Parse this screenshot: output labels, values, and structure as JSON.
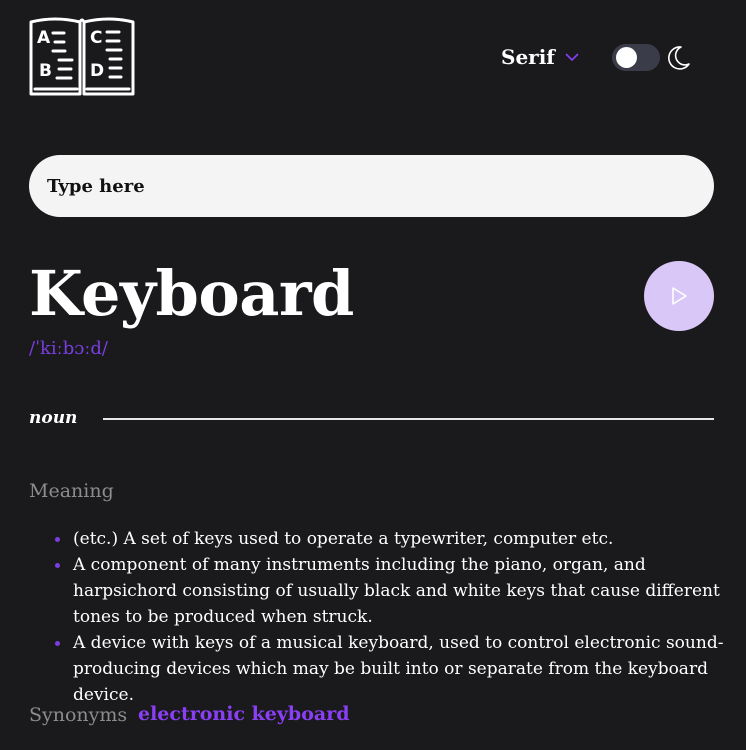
{
  "header": {
    "logo_letters": [
      "A",
      "B",
      "C",
      "D"
    ],
    "font_select": {
      "value": "Serif"
    },
    "theme_toggle": {
      "state": "off"
    }
  },
  "search": {
    "placeholder": "Type here"
  },
  "entry": {
    "word": "Keyboard",
    "phonetic": "/ˈkiːbɔːd/",
    "part_of_speech": "noun",
    "meaning_label": "Meaning",
    "definitions": [
      "(etc.) A set of keys used to operate a typewriter, computer etc.",
      "A component of many instruments including the piano, organ, and harpsichord consisting of usually black and white keys that cause different tones to be produced when struck.",
      "A device with keys of a musical keyboard, used to control electronic sound-producing devices which may be built into or separate from the keyboard device."
    ],
    "synonyms_label": "Synonyms",
    "synonyms": [
      "electronic keyboard"
    ]
  },
  "colors": {
    "background": "#1a191c",
    "accent": "#8a3ff5",
    "play_button": "#d9c7f7",
    "muted_text": "#8c8c8c"
  },
  "icons": {
    "logo": "dictionary-book-icon",
    "dropdown": "chevron-down-icon",
    "theme": "moon-icon",
    "play": "play-icon"
  }
}
